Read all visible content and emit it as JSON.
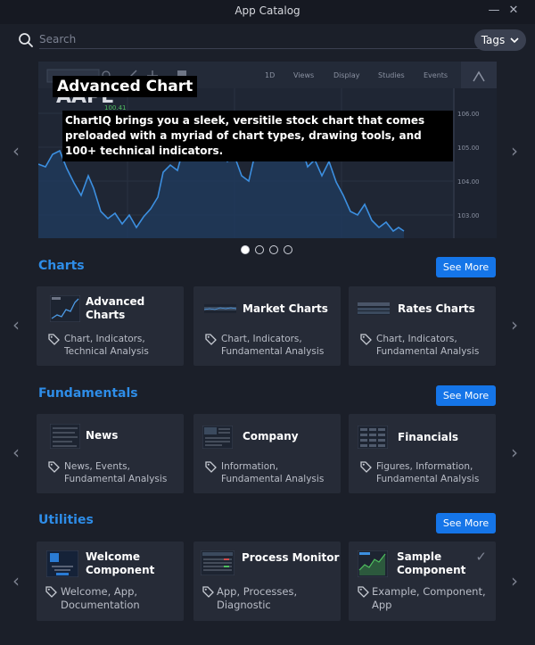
{
  "window": {
    "title": "App Catalog",
    "minimize": "—",
    "close": "✕"
  },
  "search": {
    "placeholder": "Search",
    "value": ""
  },
  "tags_button": {
    "label": "Tags"
  },
  "hero": {
    "title": "Advanced Chart",
    "description": "ChartIQ brings you a sleek, versitile stock chart that comes preloaded with a myriad of chart types, drawing tools, and 100+ technical indicators.",
    "toolbar": [
      "1D",
      "Views",
      "Display",
      "Studies",
      "Events"
    ],
    "symbol": "AAPL",
    "price": "100.41",
    "axis_ticks": [
      "106.00",
      "105.00",
      "104.00",
      "103.00"
    ],
    "pages": 4,
    "active_page": 0
  },
  "nav": {
    "prev": "‹",
    "next": "›"
  },
  "sections": [
    {
      "title": "Charts",
      "see_more": "See More",
      "cards": [
        {
          "name": "Advanced Charts",
          "tags": "Chart, Indicators, Technical Analysis"
        },
        {
          "name": "Market Charts",
          "tags": "Chart, Indicators, Fundamental Analysis"
        },
        {
          "name": "Rates Charts",
          "tags": "Chart, Indicators, Fundamental Analysis"
        }
      ]
    },
    {
      "title": "Fundamentals",
      "see_more": "See More",
      "cards": [
        {
          "name": "News",
          "tags": "News, Events, Fundamental Analysis"
        },
        {
          "name": "Company",
          "tags": "Information, Fundamental Analysis"
        },
        {
          "name": "Financials",
          "tags": "Figures, Information, Fundamental Analysis"
        }
      ]
    },
    {
      "title": "Utilities",
      "see_more": "See More",
      "cards": [
        {
          "name": "Welcome Component",
          "tags": "Welcome,  App, Documentation"
        },
        {
          "name": "Process Monitor",
          "tags": "App, Processes, Diagnostic"
        },
        {
          "name": "Sample Component",
          "tags": "Example,  Component, App",
          "checked": true,
          "check": "✓"
        }
      ]
    }
  ],
  "colors": {
    "background": "#1b1f29",
    "card": "#262b37",
    "accent": "#1575e8",
    "section_title": "#2e8de8"
  }
}
